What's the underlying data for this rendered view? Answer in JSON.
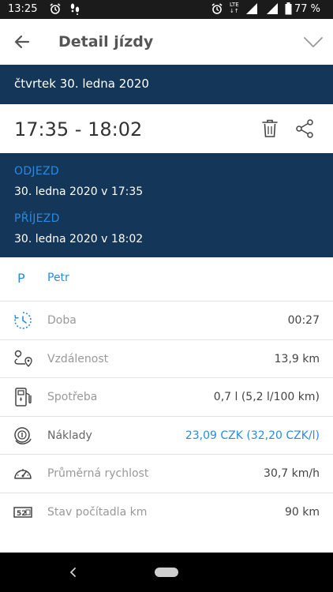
{
  "status_bar": {
    "time": "13:25",
    "network": "LTE",
    "battery": "77 %"
  },
  "header": {
    "title": "Detail jízdy"
  },
  "trip": {
    "date_heading": "čtvrtek 30. ledna 2020",
    "time_range": "17:35 - 18:02",
    "departure_label": "ODJEZD",
    "departure_value": "30. ledna 2020 v 17:35",
    "arrival_label": "PŘÍJEZD",
    "arrival_value": "30. ledna 2020 v 18:02"
  },
  "driver": {
    "initial": "P",
    "name": "Petr"
  },
  "details": [
    {
      "label": "Doba",
      "value": "00:27",
      "icon": "timer-icon"
    },
    {
      "label": "Vzdálenost",
      "value": "13,9 km",
      "icon": "route-icon"
    },
    {
      "label": "Spotřeba",
      "value": "0,7 l (5,2 l/100 km)",
      "icon": "fuel-pump-icon"
    },
    {
      "label": "Náklady",
      "value": "23,09 CZK (32,20 CZK/l)",
      "icon": "coins-icon"
    },
    {
      "label": "Průměrná rychlost",
      "value": "30,7 km/h",
      "icon": "speedometer-icon"
    },
    {
      "label": "Stav počítadla km",
      "value": "90 km",
      "icon": "odometer-icon"
    }
  ],
  "colors": {
    "band": "#133659",
    "accent": "#2b8ae0"
  }
}
